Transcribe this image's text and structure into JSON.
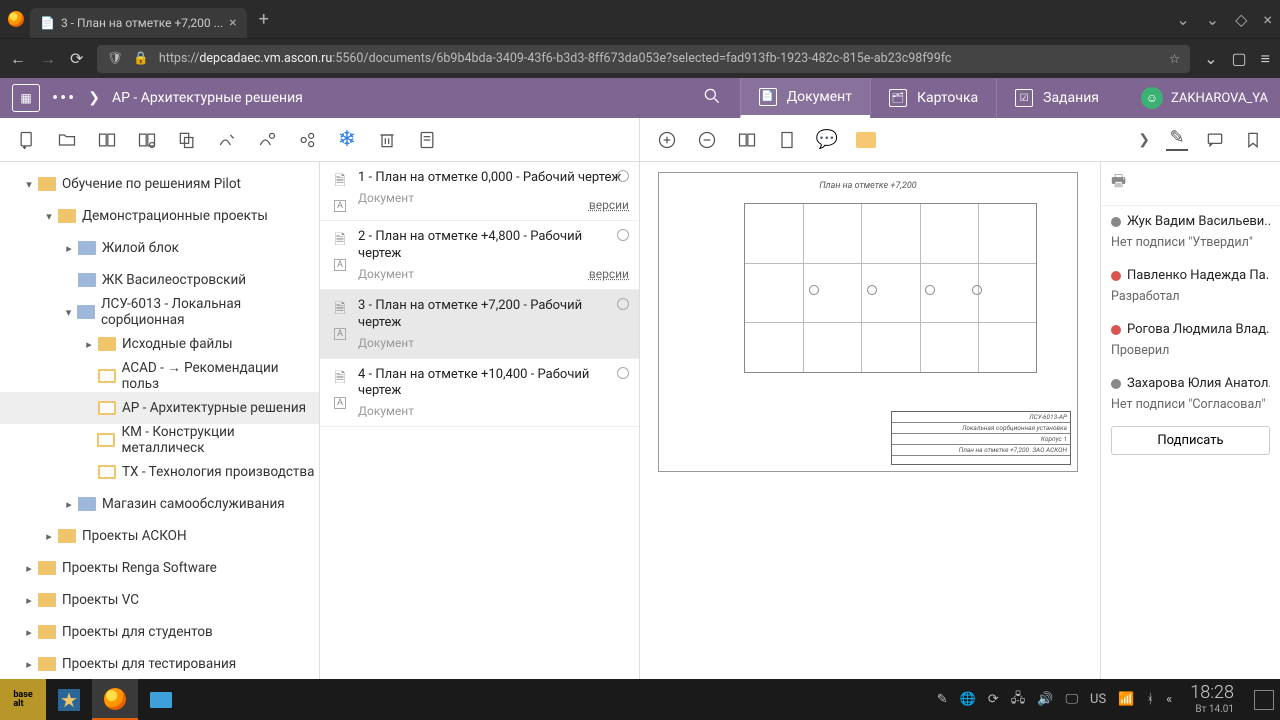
{
  "browser": {
    "tab_title": "3 - План на отметке +7,200 ...",
    "url_prefix": "https://",
    "url_host": "depcadaec.vm.ascon.ru",
    "url_rest": ":5560/documents/6b9b4bda-3409-43f6-b3d3-8ff673da053e?selected=fad913fb-1923-482c-815e-ab23c98f99fc"
  },
  "header": {
    "breadcrumb": "АР - Архитектурные решения",
    "tabs": [
      {
        "label": "Документ",
        "active": true
      },
      {
        "label": "Карточка",
        "active": false
      },
      {
        "label": "Задания",
        "active": false
      }
    ],
    "user": "ZAKHAROVA_YA"
  },
  "tree": [
    {
      "d": 0,
      "tw": "▾",
      "ico": "fold",
      "label": "Обучение по решениям Pilot"
    },
    {
      "d": 1,
      "tw": "▾",
      "ico": "fold",
      "label": "Демонстрационные проекты"
    },
    {
      "d": 2,
      "tw": "▸",
      "ico": "blue",
      "label": "Жилой блок"
    },
    {
      "d": 2,
      "tw": "",
      "ico": "blue",
      "label": "ЖК Василеостровский"
    },
    {
      "d": 2,
      "tw": "▾",
      "ico": "blue",
      "label": "ЛСУ-6013 - Локальная сорбционная"
    },
    {
      "d": 3,
      "tw": "▸",
      "ico": "fold",
      "label": "Исходные файлы"
    },
    {
      "d": 3,
      "tw": "",
      "ico": "doc",
      "label": "ACAD - → Рекомендации польз"
    },
    {
      "d": 3,
      "tw": "",
      "ico": "doc",
      "label": "АР - Архитектурные решения",
      "sel": true
    },
    {
      "d": 3,
      "tw": "",
      "ico": "doc",
      "label": "КМ - Конструкции металлическ"
    },
    {
      "d": 3,
      "tw": "",
      "ico": "doc",
      "label": "ТХ - Технология производства"
    },
    {
      "d": 2,
      "tw": "▸",
      "ico": "blue",
      "label": "Магазин самообслуживания"
    },
    {
      "d": 1,
      "tw": "▸",
      "ico": "fold",
      "label": "Проекты АСКОН"
    },
    {
      "d": 0,
      "tw": "▸",
      "ico": "fold",
      "label": "Проекты Renga Software"
    },
    {
      "d": 0,
      "tw": "▸",
      "ico": "fold",
      "label": "Проекты VC"
    },
    {
      "d": 0,
      "tw": "▸",
      "ico": "fold",
      "label": "Проекты для студентов"
    },
    {
      "d": 0,
      "tw": "▸",
      "ico": "fold",
      "label": "Проекты для тестирования"
    }
  ],
  "docs": {
    "sub": "Документ",
    "versions": "версии",
    "items": [
      {
        "title": "1 - План на отметке 0,000 - Рабочий чертеж",
        "versions": true
      },
      {
        "title": "2 - План на отметке +4,800 - Рабочий чертеж",
        "versions": true
      },
      {
        "title": "3 - План на отметке +7,200 - Рабочий чертеж",
        "sel": true
      },
      {
        "title": "4 - План на отметке +10,400 - Рабочий чертеж"
      }
    ]
  },
  "drawing": {
    "title": "План на отметке +7,200",
    "stamp": {
      "l1": "ЛСУ-6013-АР",
      "l2": "Локальная сорбционная установка",
      "l3": "Корпус 1",
      "l4_left": "План на отметке +7,200",
      "l4_right": "ЗАО АСКОН"
    }
  },
  "signatures": {
    "entries": [
      {
        "dot": "gray",
        "name": "Жук Вадим Васильеви...",
        "role": "Нет подписи \"Утвердил\""
      },
      {
        "dot": "red",
        "name": "Павленко Надежда Па...",
        "role": "Разработал"
      },
      {
        "dot": "red",
        "name": "Рогова Людмила Влад...",
        "role": "Проверил"
      },
      {
        "dot": "gray",
        "name": "Захарова Юлия Анатол...",
        "role": "Нет подписи \"Согласовал\""
      }
    ],
    "sign_btn": "Подписать"
  },
  "taskbar": {
    "lang": "US",
    "time": "18:28",
    "date": "Вт 14.01"
  }
}
